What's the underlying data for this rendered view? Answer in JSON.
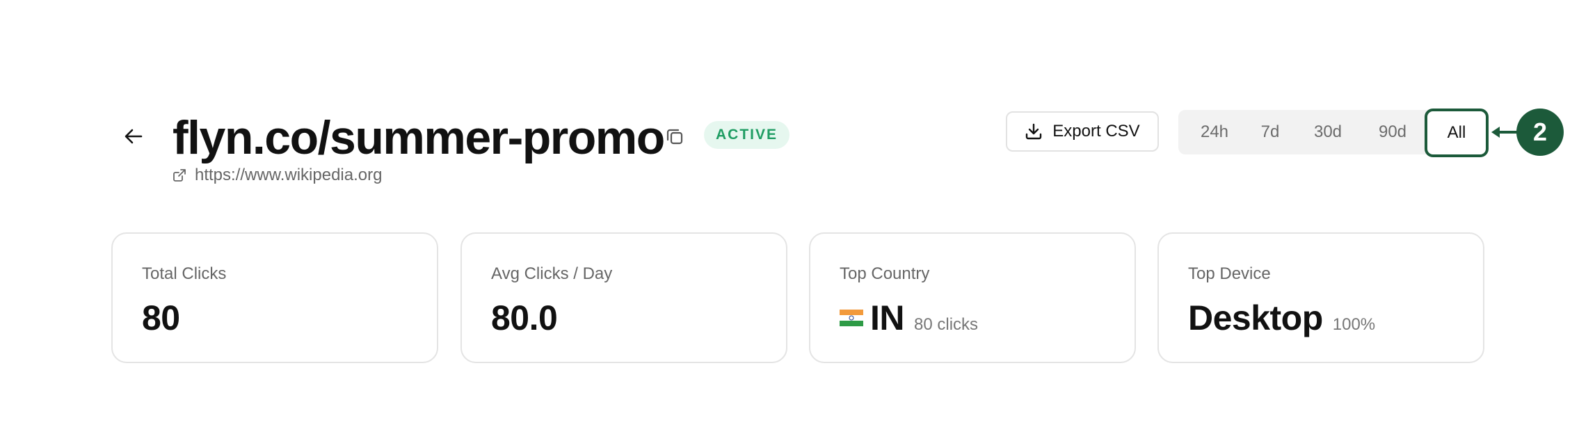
{
  "header": {
    "title": "flyn.co/summer-promo",
    "status": "ACTIVE",
    "destination_url": "https://www.wikipedia.org",
    "back_icon": "arrow-left-icon",
    "copy_icon": "copy-icon",
    "external_link_icon": "external-link-icon"
  },
  "toolbar": {
    "export_label": "Export CSV",
    "export_icon": "download-icon",
    "ranges": [
      "24h",
      "7d",
      "30d",
      "90d",
      "All"
    ],
    "selected_range": "All"
  },
  "annotation": {
    "step_number": "2",
    "color": "#1c5a3a"
  },
  "stats": {
    "total_clicks": {
      "label": "Total Clicks",
      "value": "80"
    },
    "avg_clicks": {
      "label": "Avg Clicks / Day",
      "value": "80.0"
    },
    "top_country": {
      "label": "Top Country",
      "value": "IN",
      "sub": "80 clicks",
      "flag": "india-flag-icon"
    },
    "top_device": {
      "label": "Top Device",
      "value": "Desktop",
      "sub": "100%"
    }
  },
  "colors": {
    "status_bg": "#e6f7ef",
    "status_text": "#1f9d63",
    "accent_dark_green": "#1c5a3a"
  }
}
